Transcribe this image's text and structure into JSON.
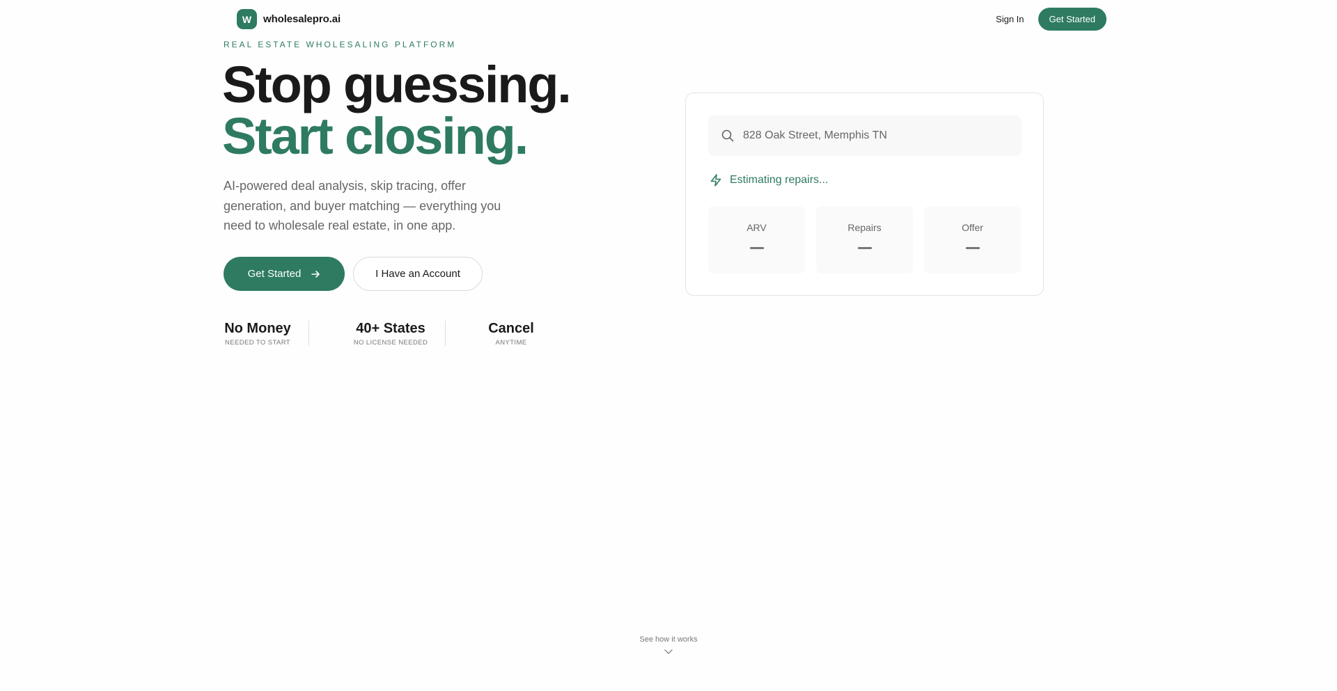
{
  "header": {
    "logo_letter": "W",
    "brand": "wholesalepro.ai",
    "sign_in": "Sign In",
    "cta": "Get Started"
  },
  "hero": {
    "eyebrow": "REAL ESTATE WHOLESALING PLATFORM",
    "headline_line1": "Stop guessing.",
    "headline_line2": "Start closing.",
    "subtext": "AI-powered deal analysis, skip tracing, offer generation, and buyer matching — everything you need to wholesale real estate, in one app.",
    "primary_button": "Get Started",
    "secondary_button": "I Have an Account"
  },
  "stats": [
    {
      "value": "No Money",
      "label": "NEEDED TO START"
    },
    {
      "value": "40+ States",
      "label": "NO LICENSE NEEDED"
    },
    {
      "value": "Cancel",
      "label": "ANYTIME"
    }
  ],
  "demo": {
    "search_value": "828 Oak Street, Memphis TN",
    "status": "Estimating repairs...",
    "metrics": [
      {
        "label": "ARV",
        "value": "—"
      },
      {
        "label": "Repairs",
        "value": "—"
      },
      {
        "label": "Offer",
        "value": "—"
      }
    ]
  },
  "scroll_hint": "See how it works",
  "icons": {
    "search": "search-icon",
    "status": "lightning-icon",
    "arrow": "arrow-right-icon",
    "chevron": "chevron-down-icon"
  },
  "colors": {
    "accent": "#2e7b61",
    "text": "#1a1a1a",
    "muted": "#666666"
  }
}
